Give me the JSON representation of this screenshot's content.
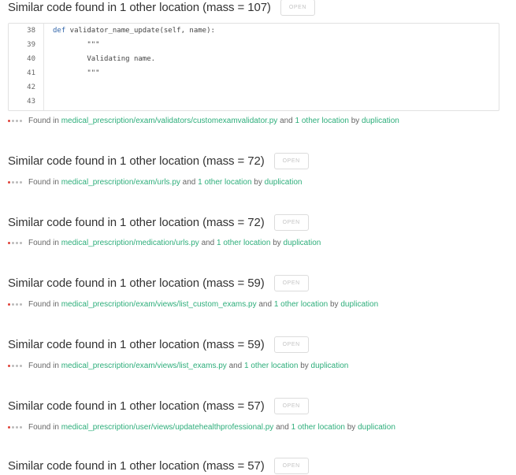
{
  "issues": [
    {
      "title": "Similar code found in 1 other location (mass = 107)",
      "open_label": "OPEN",
      "found_in_label": "Found in",
      "path": "medical_prescription/exam/validators/customexamvalidator.py",
      "and_label": "and",
      "other_location": "1 other location",
      "by_label": "by",
      "engine": "duplication",
      "code": [
        {
          "ln": "38",
          "kw": "def",
          "text": " validator_name_update(self, name):"
        },
        {
          "ln": "39",
          "kw": "",
          "text": "        \"\"\""
        },
        {
          "ln": "40",
          "kw": "",
          "text": "        Validating name."
        },
        {
          "ln": "41",
          "kw": "",
          "text": "        \"\"\""
        },
        {
          "ln": "42",
          "kw": "",
          "text": ""
        },
        {
          "ln": "43",
          "kw": "",
          "text": ""
        }
      ]
    },
    {
      "title": "Similar code found in 1 other location (mass = 72)",
      "open_label": "OPEN",
      "found_in_label": "Found in",
      "path": "medical_prescription/exam/urls.py",
      "and_label": "and",
      "other_location": "1 other location",
      "by_label": "by",
      "engine": "duplication"
    },
    {
      "title": "Similar code found in 1 other location (mass = 72)",
      "open_label": "OPEN",
      "found_in_label": "Found in",
      "path": "medical_prescription/medication/urls.py",
      "and_label": "and",
      "other_location": "1 other location",
      "by_label": "by",
      "engine": "duplication"
    },
    {
      "title": "Similar code found in 1 other location (mass = 59)",
      "open_label": "OPEN",
      "found_in_label": "Found in",
      "path": "medical_prescription/exam/views/list_custom_exams.py",
      "and_label": "and",
      "other_location": "1 other location",
      "by_label": "by",
      "engine": "duplication"
    },
    {
      "title": "Similar code found in 1 other location (mass = 59)",
      "open_label": "OPEN",
      "found_in_label": "Found in",
      "path": "medical_prescription/exam/views/list_exams.py",
      "and_label": "and",
      "other_location": "1 other location",
      "by_label": "by",
      "engine": "duplication"
    },
    {
      "title": "Similar code found in 1 other location (mass = 57)",
      "open_label": "OPEN",
      "found_in_label": "Found in",
      "path": "medical_prescription/user/views/updatehealthprofessional.py",
      "and_label": "and",
      "other_location": "1 other location",
      "by_label": "by",
      "engine": "duplication"
    },
    {
      "title": "Similar code found in 1 other location (mass = 57)",
      "open_label": "OPEN"
    }
  ],
  "colors": {
    "link": "#2eae7b",
    "severity_dot": "#e0433a",
    "keyword": "#3366aa"
  }
}
